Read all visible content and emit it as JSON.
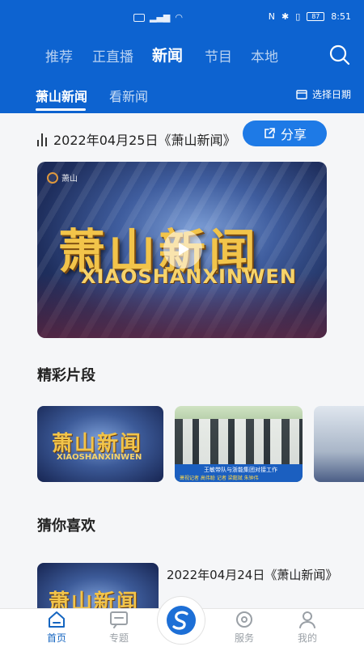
{
  "status_bar": {
    "time": "8:51",
    "battery": "87"
  },
  "top_nav": {
    "tabs": [
      {
        "label": "推荐",
        "active": false
      },
      {
        "label": "正直播",
        "active": false
      },
      {
        "label": "新闻",
        "active": true
      },
      {
        "label": "节目",
        "active": false
      },
      {
        "label": "本地",
        "active": false
      }
    ],
    "search_icon": "search-icon"
  },
  "sub_nav": {
    "tabs": [
      {
        "label": "萧山新闻",
        "active": true
      },
      {
        "label": "看新闻",
        "active": false
      }
    ],
    "date_picker_label": "选择日期"
  },
  "news_header": {
    "title": "2022年04月25日《萧山新闻》",
    "share_label": "分享"
  },
  "hero": {
    "brand": "萧山",
    "logo_text": "萧山新闻",
    "pinyin": "XIAOSHANXINWEN"
  },
  "clips_section": {
    "title": "精彩片段",
    "clips": [
      {
        "logo_text": "萧山新闻",
        "pinyin": "XIAOSHANXINWEN"
      },
      {
        "caption": "王敏带队与浙能集团对接工作",
        "credits": "萧视记者 高伟聪 记者 梁懿斌 朱钟伟"
      },
      {}
    ]
  },
  "recommend_section": {
    "title": "猜你喜欢",
    "items": [
      {
        "logo_text": "萧山新闻",
        "title": "2022年04月24日《萧山新闻》"
      }
    ]
  },
  "bottom_nav": {
    "items": [
      {
        "label": "首页",
        "active": true
      },
      {
        "label": "专题",
        "active": false
      },
      {
        "label": "",
        "active": false
      },
      {
        "label": "服务",
        "active": false
      },
      {
        "label": "我的",
        "active": false
      }
    ]
  },
  "colors": {
    "primary": "#0d63d0",
    "accent": "#1e7ae6",
    "active_tab": "#1565c0"
  }
}
